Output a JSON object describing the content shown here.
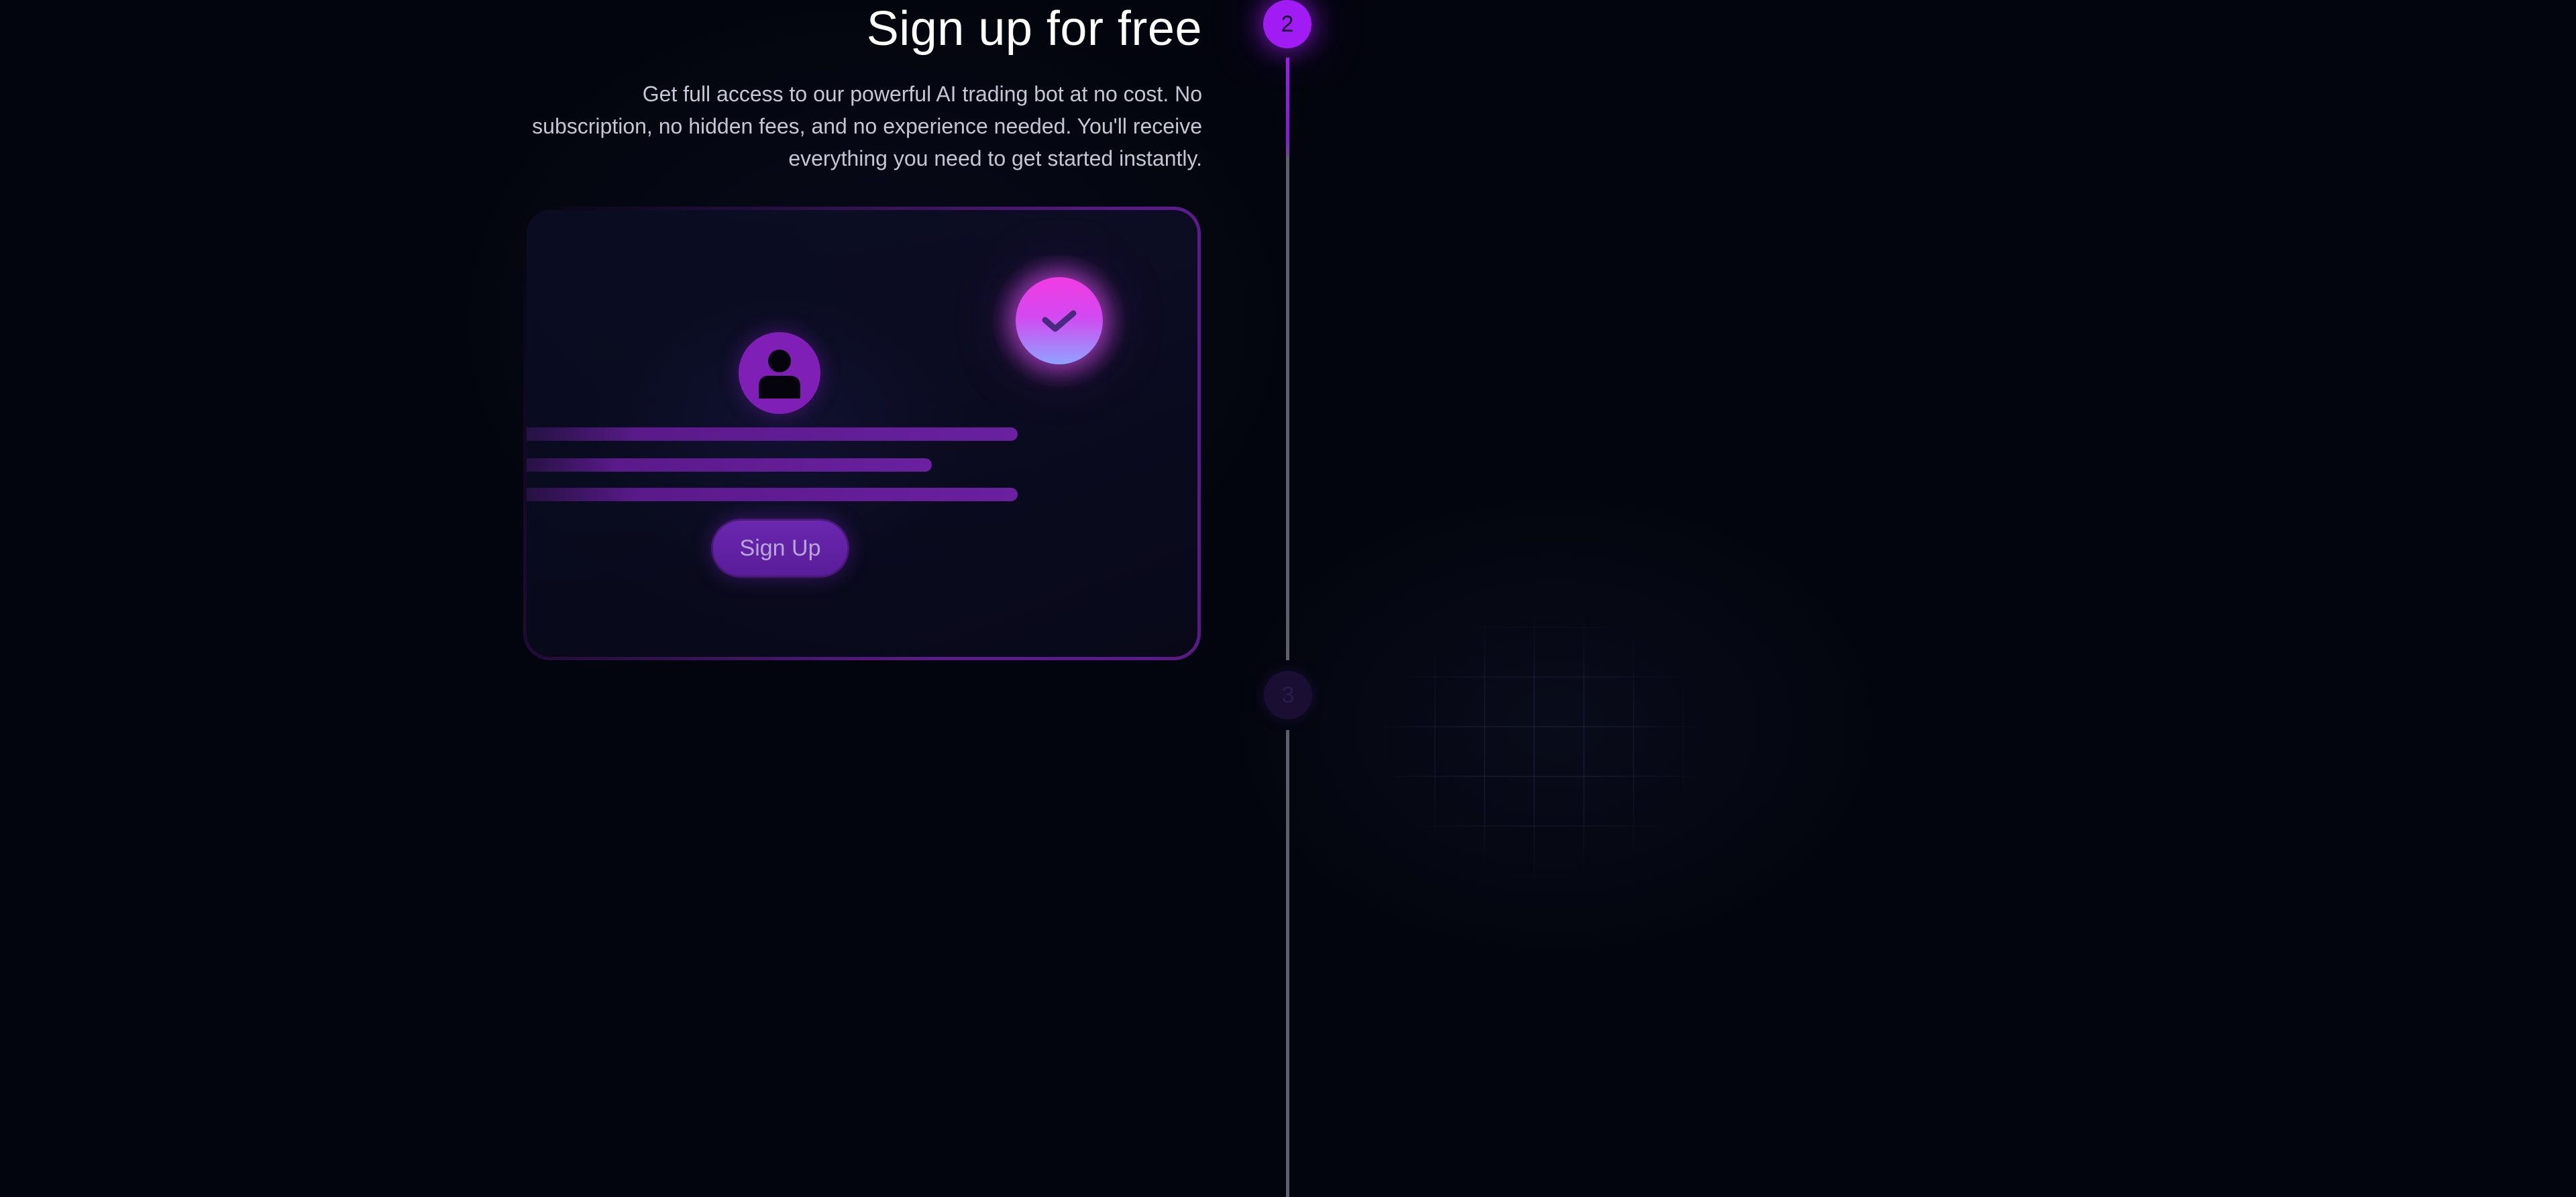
{
  "timeline": {
    "active_step_number": "2",
    "next_step_number": "3",
    "accent_color": "#a11cf2"
  },
  "step": {
    "title": "Sign up for free",
    "description": "Get full access to our powerful AI trading bot at no cost. No subscription, no hidden fees, and no experience needed. You'll receive everything you need to get started instantly."
  },
  "card": {
    "avatar_icon": "user-icon",
    "badge_icon": "check-icon",
    "signup_button_label": "Sign Up",
    "badge_gradient": [
      "#f23be3",
      "#8fa2ff"
    ]
  },
  "colors": {
    "background": "#03050e",
    "text_primary": "#ffffff",
    "text_secondary": "#c4c6d4",
    "card_border": "#5d1b8a",
    "avatar": "#7f1fb6"
  }
}
